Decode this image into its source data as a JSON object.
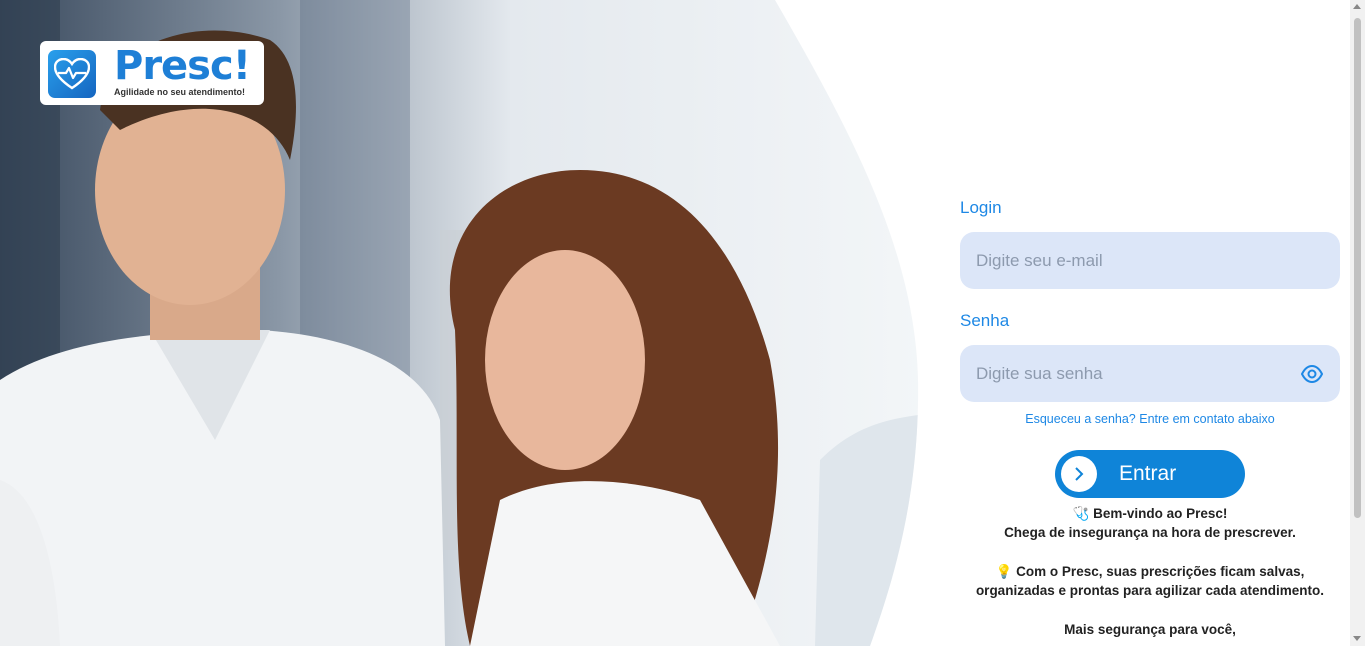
{
  "brand": {
    "name": "Presc!",
    "tagline": "Agilidade no seu atendimento!"
  },
  "login": {
    "label": "Login",
    "placeholder": "Digite seu e-mail"
  },
  "password": {
    "label": "Senha",
    "placeholder": "Digite sua senha"
  },
  "forgot_link": "Esqueceu a senha? Entre em contato abaixo",
  "submit": {
    "label": "Entrar"
  },
  "welcome": {
    "line1": "🩺 Bem-vindo ao Presc!",
    "line2": "Chega de insegurança na hora de prescrever.",
    "line3": "💡 Com o Presc, suas prescrições ficam salvas,",
    "line4": "organizadas e prontas para agilizar cada atendimento.",
    "line5": "Mais segurança para você,"
  },
  "colors": {
    "accent": "#1e88e5",
    "button": "#0f84d8",
    "input_bg": "#dce6f8"
  },
  "icons": {
    "logo": "heart-pulse-icon",
    "password_toggle": "eye-icon",
    "submit": "chevron-right-icon"
  }
}
